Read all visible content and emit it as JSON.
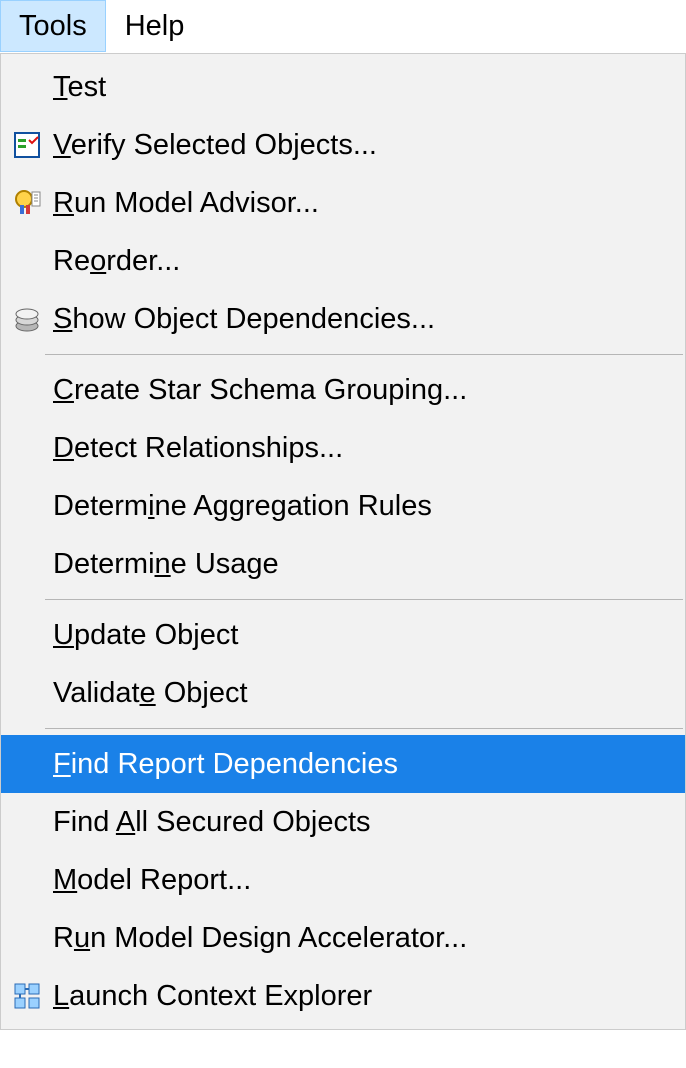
{
  "menubar": {
    "tools": "Tools",
    "help": "Help"
  },
  "menu": {
    "groups": [
      [
        {
          "key": "test",
          "pre": "",
          "mn": "T",
          "post": "est",
          "icon": null
        },
        {
          "key": "verify",
          "pre": "",
          "mn": "V",
          "post": "erify Selected Objects...",
          "icon": "verify"
        },
        {
          "key": "runadvisor",
          "pre": "",
          "mn": "R",
          "post": "un Model Advisor...",
          "icon": "advisor"
        },
        {
          "key": "reorder",
          "pre": "Re",
          "mn": "o",
          "post": "rder...",
          "icon": null
        },
        {
          "key": "showdep",
          "pre": "",
          "mn": "S",
          "post": "how Object Dependencies...",
          "icon": "layers"
        }
      ],
      [
        {
          "key": "starschema",
          "pre": "",
          "mn": "C",
          "post": "reate Star Schema Grouping...",
          "icon": null
        },
        {
          "key": "detectrel",
          "pre": "",
          "mn": "D",
          "post": "etect Relationships...",
          "icon": null
        },
        {
          "key": "detagg",
          "pre": "Determ",
          "mn": "i",
          "post": "ne Aggregation Rules",
          "icon": null
        },
        {
          "key": "detusage",
          "pre": "Determi",
          "mn": "n",
          "post": "e Usage",
          "icon": null
        }
      ],
      [
        {
          "key": "updobj",
          "pre": "",
          "mn": "U",
          "post": "pdate Object",
          "icon": null
        },
        {
          "key": "valobj",
          "pre": "Validat",
          "mn": "e",
          "post": " Object",
          "icon": null
        }
      ],
      [
        {
          "key": "findrep",
          "pre": "",
          "mn": "F",
          "post": "ind Report Dependencies",
          "icon": null,
          "highlighted": true
        },
        {
          "key": "findall",
          "pre": "Find ",
          "mn": "A",
          "post": "ll Secured Objects",
          "icon": null
        },
        {
          "key": "modelrep",
          "pre": "",
          "mn": "M",
          "post": "odel Report...",
          "icon": null
        },
        {
          "key": "rundesign",
          "pre": "R",
          "mn": "u",
          "post": "n Model Design Accelerator...",
          "icon": null
        },
        {
          "key": "launchctx",
          "pre": "",
          "mn": "L",
          "post": "aunch Context Explorer",
          "icon": "context"
        }
      ]
    ]
  }
}
